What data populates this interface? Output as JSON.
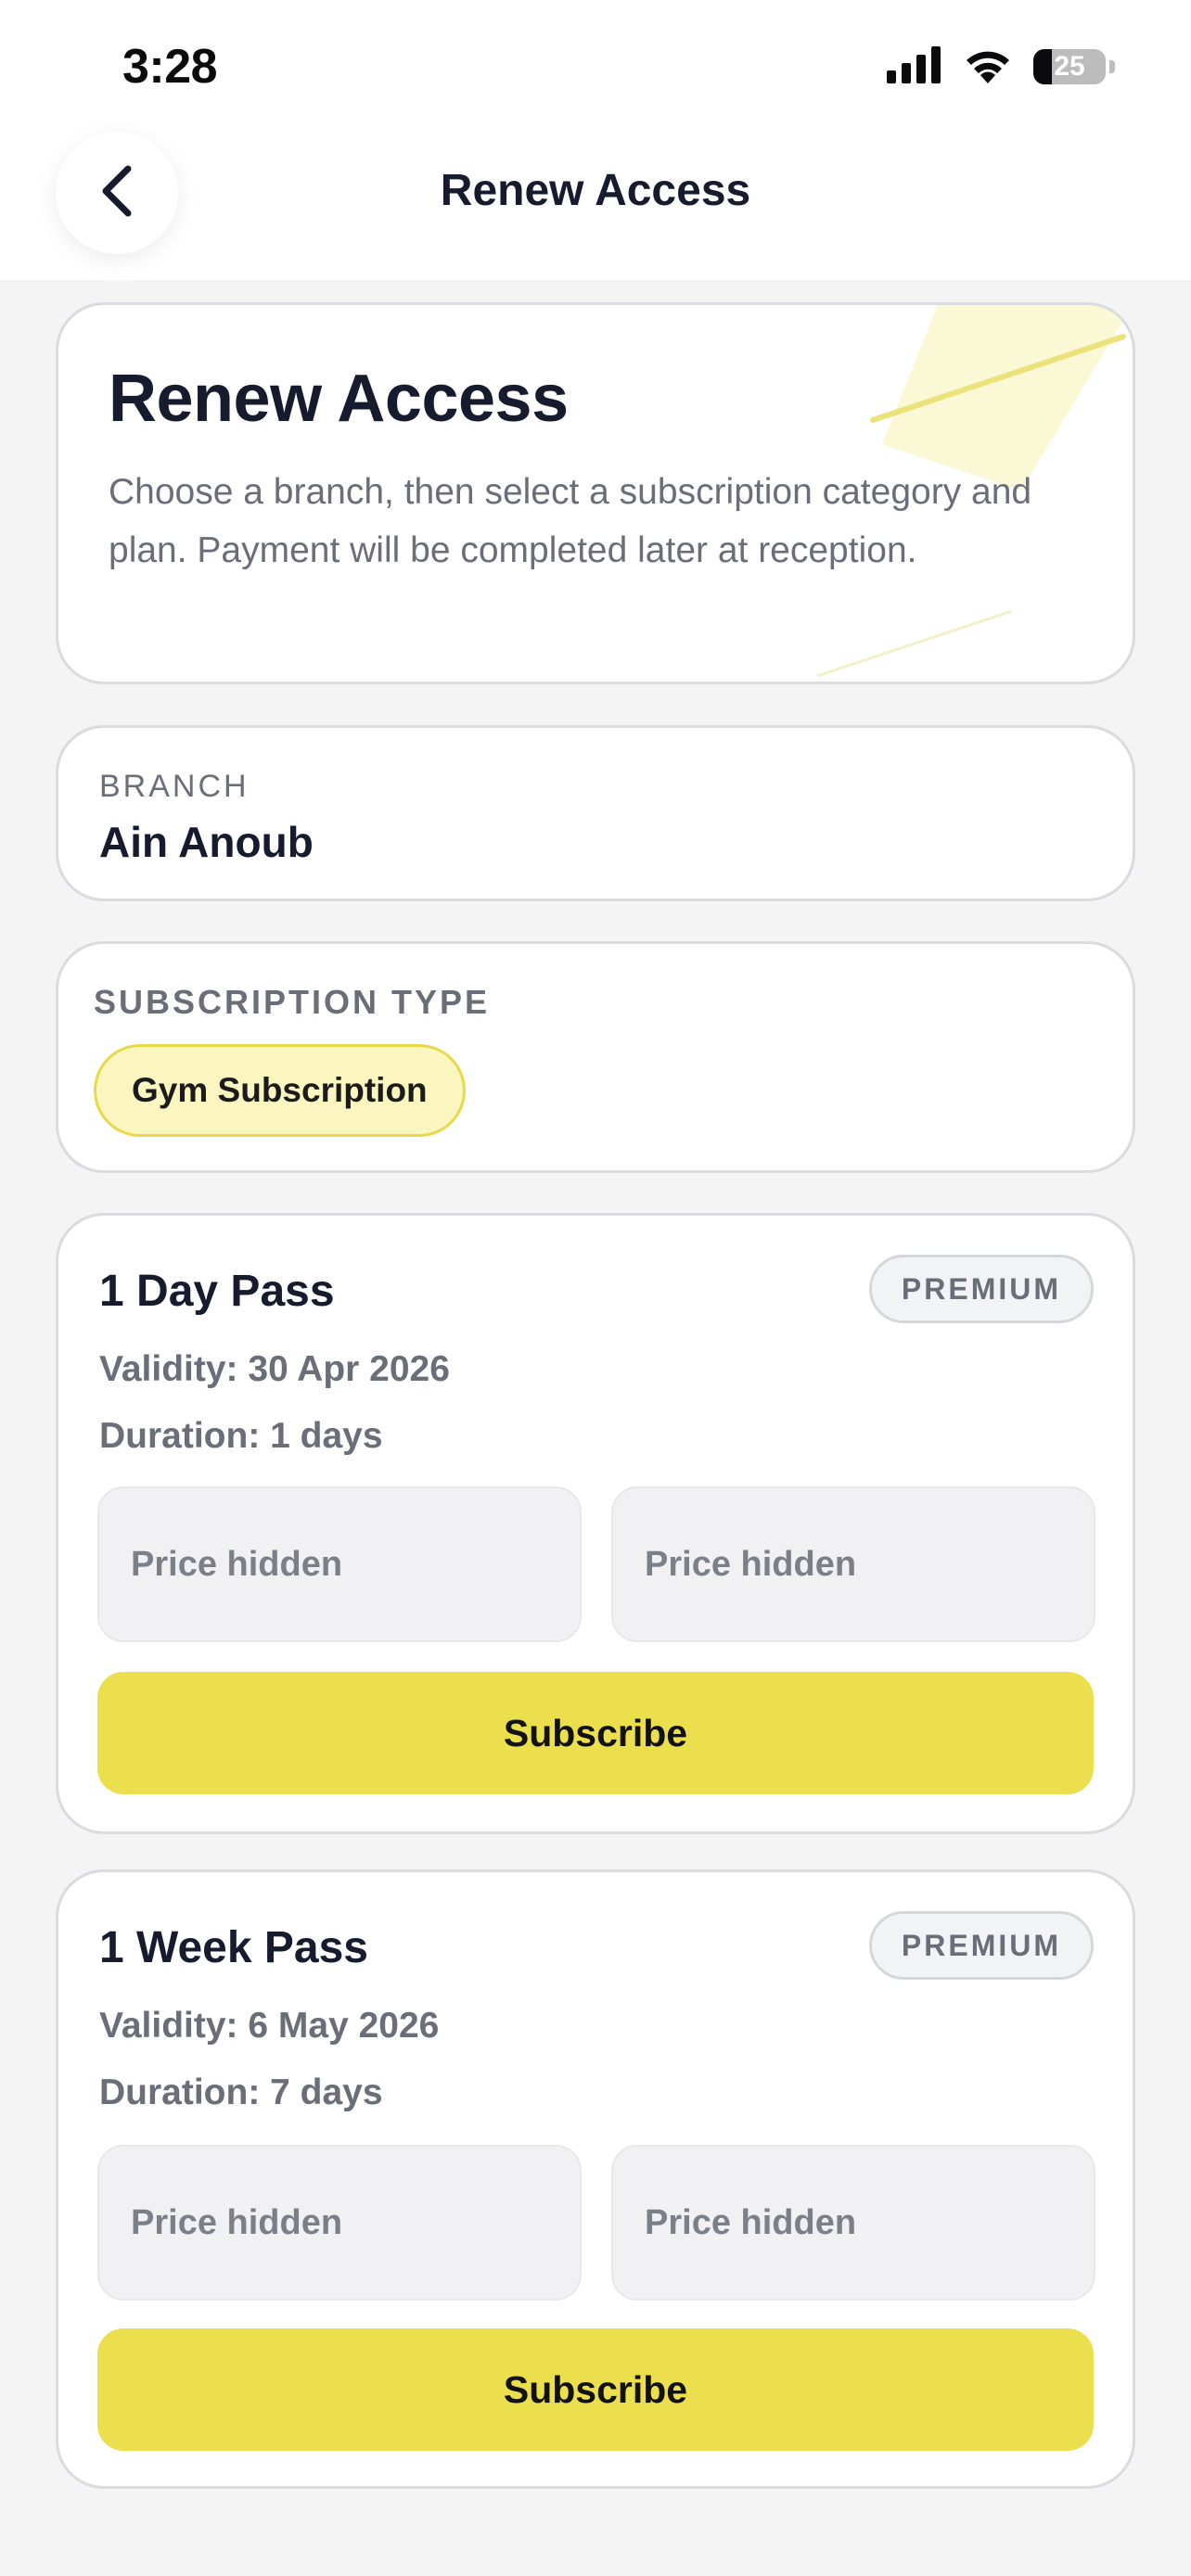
{
  "status_bar": {
    "time": "3:28",
    "battery": "25",
    "battery_level": 0.25,
    "icons": [
      "cellular-signal-icon",
      "wifi-icon",
      "battery-icon"
    ]
  },
  "header": {
    "title": "Renew Access",
    "back_icon": "chevron-left-icon"
  },
  "intro": {
    "title": "Renew Access",
    "text": "Choose a branch, then select a subscription category and plan. Payment will be completed later at reception."
  },
  "branch": {
    "label": "BRANCH",
    "value": "Ain Anoub"
  },
  "subscription_type": {
    "label": "SUBSCRIPTION TYPE",
    "selected": "Gym Subscription"
  },
  "plans": [
    {
      "title": "1 Day Pass",
      "badge": "PREMIUM",
      "validity": "Validity: 30 Apr 2026",
      "duration": "Duration: 1 days",
      "price_left": "Price hidden",
      "price_right": "Price hidden",
      "button": "Subscribe"
    },
    {
      "title": "1 Week Pass",
      "badge": "PREMIUM",
      "validity": "Validity: 6 May 2026",
      "duration": "Duration: 7 days",
      "price_left": "Price hidden",
      "price_right": "Price hidden",
      "button": "Subscribe"
    }
  ],
  "colors": {
    "accent": "#ebdf4e",
    "chip_bg": "#fbf5c0",
    "chip_border": "#e7d94a",
    "text_primary": "#161b2e",
    "text_secondary": "#6a6e79",
    "background": "#f4f4f5"
  }
}
